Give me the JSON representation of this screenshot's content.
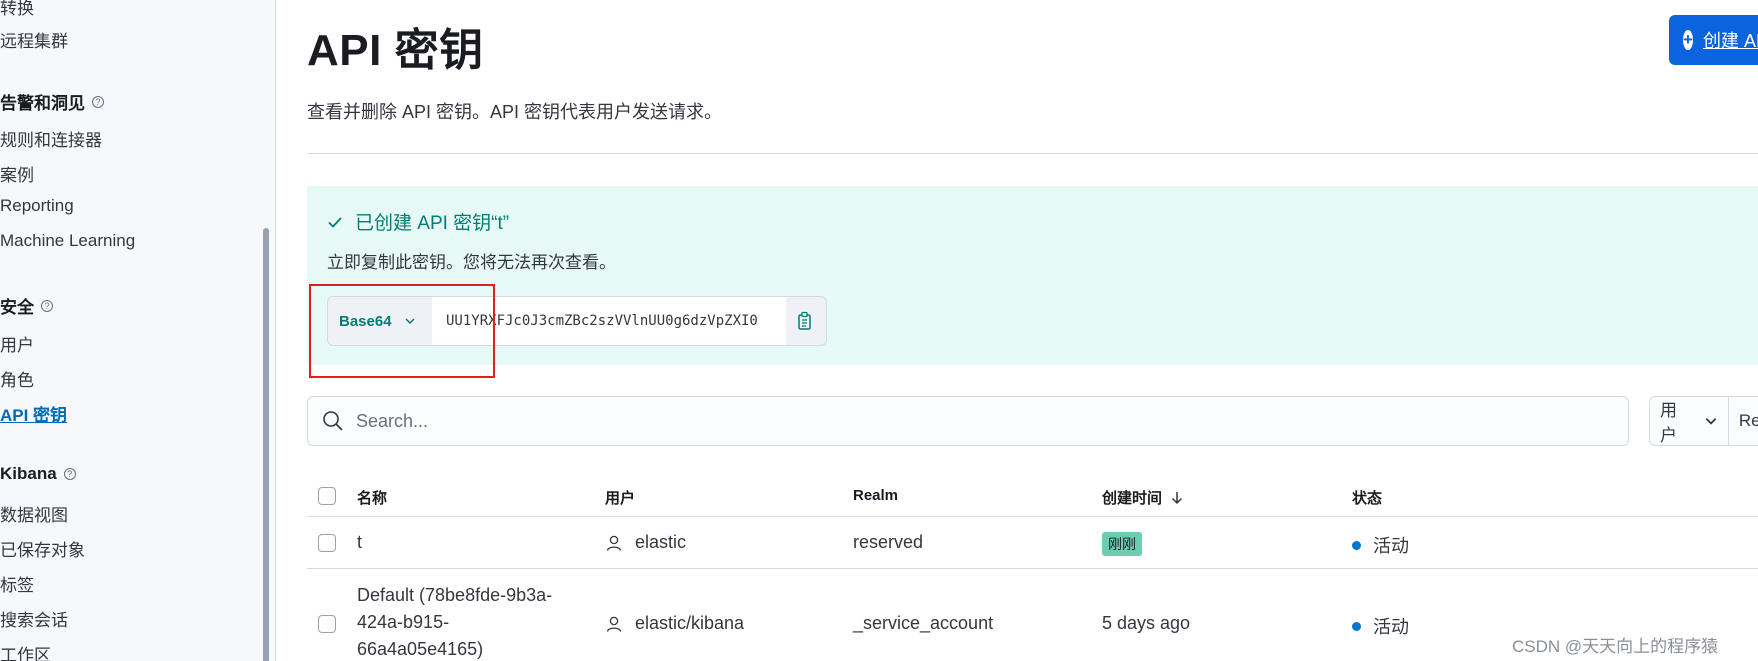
{
  "sidebar": {
    "top_items": [
      "转换",
      "远程集群"
    ],
    "groups": [
      {
        "title": "告警和洞见",
        "items": [
          "规则和连接器",
          "案例",
          "Reporting",
          "Machine Learning"
        ]
      },
      {
        "title": "安全",
        "items": [
          "用户",
          "角色",
          "API 密钥"
        ]
      },
      {
        "title": "Kibana",
        "items": [
          "数据视图",
          "已保存对象",
          "标签",
          "搜索会话",
          "工作区"
        ]
      }
    ],
    "active_item": "API 密钥"
  },
  "header": {
    "title": "API 密钥",
    "create_button_label": "创建 API 密钥",
    "subtitle": "查看并删除 API 密钥。API 密钥代表用户发送请求。"
  },
  "callout": {
    "title": "已创建 API 密钥“t”",
    "text": "立即复制此密钥。您将无法再次查看。",
    "format_label": "Base64",
    "key_value": "UU1YRXFJc0J3cmZBc2szVVlnUU0g6dzVpZXI0"
  },
  "search": {
    "placeholder": "Search..."
  },
  "filters": {
    "user_label": "用户",
    "realm_label": "Realm"
  },
  "table": {
    "columns": [
      "名称",
      "用户",
      "Realm",
      "创建时间",
      "状态"
    ],
    "rows": [
      {
        "name": "t",
        "user": "elastic",
        "realm": "reserved",
        "created": "刚刚",
        "status": "活动"
      },
      {
        "name_lines": [
          "Default (78be8fde-9b3a-",
          "424a-b915-",
          "66a4a05e4165)"
        ],
        "user": "elastic/kibana",
        "realm": "_service_account",
        "created": "5 days ago",
        "status": "活动"
      }
    ]
  },
  "watermark": "CSDN @天天向上的程序猿",
  "colors": {
    "accent": "#0b64dd",
    "success": "#017d73",
    "callout_bg": "#e6f9f7",
    "badge": "#6dccb1",
    "highlight_box": "#e02020"
  }
}
